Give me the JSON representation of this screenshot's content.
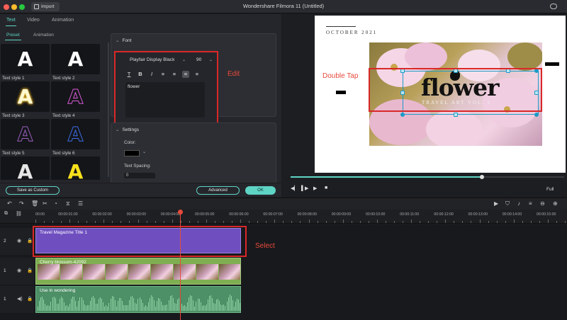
{
  "window": {
    "title": "Wondershare Filmora 11 (Untitled)",
    "import_label": "Import"
  },
  "main_tabs": [
    {
      "label": "Text",
      "active": true
    },
    {
      "label": "Video",
      "active": false
    },
    {
      "label": "Animation",
      "active": false
    }
  ],
  "sub_tabs": [
    {
      "label": "Preset",
      "active": true
    },
    {
      "label": "Animation",
      "active": false
    }
  ],
  "text_styles": [
    {
      "glyph": "A",
      "label": "Text style 1"
    },
    {
      "glyph": "A",
      "label": "Text style 2"
    },
    {
      "glyph": "A",
      "label": "Text style 3"
    },
    {
      "glyph": "A",
      "label": "Text style 4"
    },
    {
      "glyph": "A",
      "label": "Text style 5"
    },
    {
      "glyph": "A",
      "label": "Text style 6"
    },
    {
      "glyph": "A",
      "label": ""
    },
    {
      "glyph": "A",
      "label": ""
    }
  ],
  "font_section": {
    "heading": "Font",
    "font_name": "Playfair Display Black",
    "font_size": "90",
    "text_value": "flower",
    "format_icons": [
      "underline-icon",
      "bold-icon",
      "italic-icon",
      "align-left-icon",
      "align-center-icon",
      "align-right-icon",
      "align-justify-icon"
    ],
    "format_glyphs": [
      "T",
      "B",
      "I",
      "≡",
      "≡",
      "≡",
      "≡"
    ]
  },
  "settings_section": {
    "heading": "Settings",
    "color_label": "Color:",
    "color_value": "#000000",
    "spacing_label": "Text Spacing:",
    "spacing_value": "0"
  },
  "annotations": {
    "edit": "Edit",
    "double_tap": "Double Tap",
    "select": "Select"
  },
  "buttons": {
    "save_custom": "Save as Custom",
    "advanced": "Advanced",
    "ok": "OK"
  },
  "preview": {
    "date_text": "OCTOBER 2021",
    "title_text": "flower",
    "subtitle_text": "TRAVEL ART VOL. 2",
    "zoom_label": "Full",
    "progress": 0.7
  },
  "ruler_labels": [
    "00:00",
    "00:00:01:00",
    "00:00:02:00",
    "00:00:03:00",
    "00:00:04:00",
    "00:00:05:00",
    "00:00:06:00",
    "00:00:07:00",
    "00:00:08:00",
    "00:00:09:00",
    "00:00:10:00",
    "00:00:11:00",
    "00:00:12:00",
    "00:00:13:00",
    "00:00:14:00",
    "00:00:15:00"
  ],
  "tracks": [
    {
      "number": "2",
      "clip_label": "Travel Magazine Title 1",
      "kind": "title"
    },
    {
      "number": "1",
      "clip_label": "Cherry blossom-42092",
      "kind": "video"
    },
    {
      "number": "1",
      "clip_label": "Use in wondering",
      "kind": "audio"
    }
  ],
  "colors": {
    "accent": "#5ed4c5",
    "annotation_red": "#e84a3b",
    "title_clip": "#6f4fc0",
    "video_clip": "#7fae52",
    "audio_clip": "#4d8f66"
  }
}
